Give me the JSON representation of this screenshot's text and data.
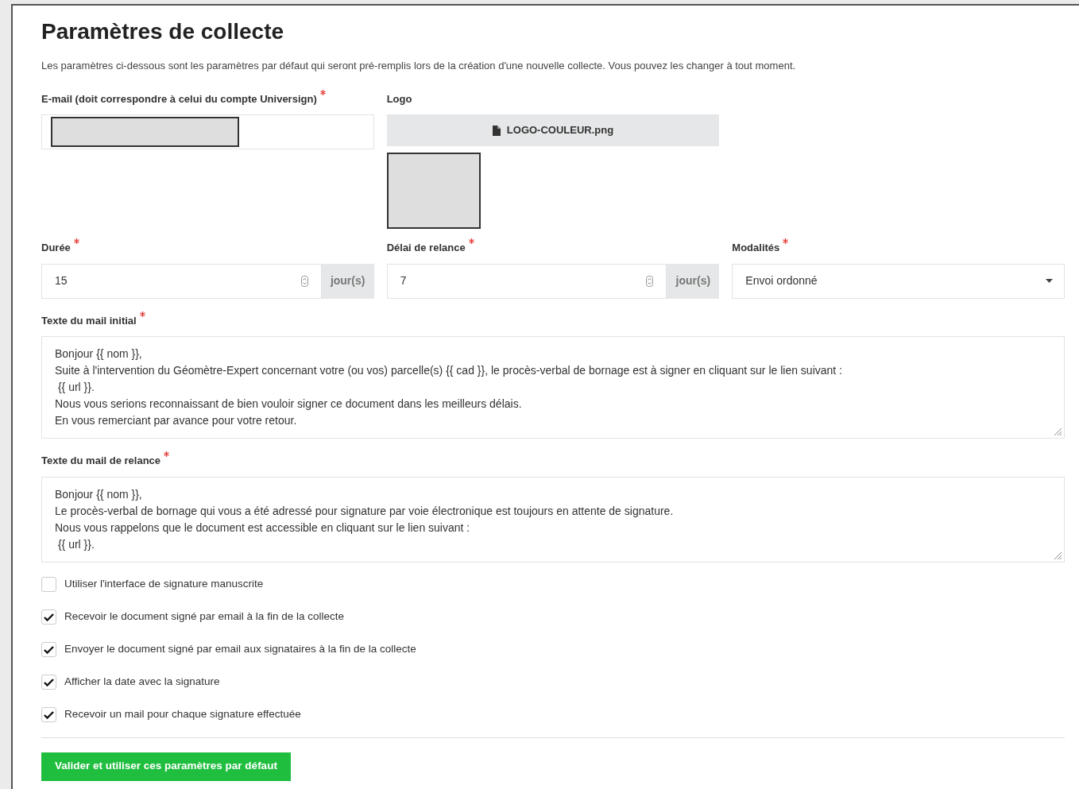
{
  "title": "Paramètres de collecte",
  "description": "Les paramètres ci-dessous sont les paramètres par défaut qui seront pré-remplis lors de la création d'une nouvelle collecte. Vous pouvez les changer à tout moment.",
  "email": {
    "label": "E-mail (doit correspondre à celui du compte Universign)",
    "required": true
  },
  "logo": {
    "label": "Logo",
    "file_name": "LOGO-COULEUR.png"
  },
  "duration": {
    "label": "Durée",
    "required": true,
    "value": "15",
    "unit": "jour(s)"
  },
  "reminder_delay": {
    "label": "Délai de relance",
    "required": true,
    "value": "7",
    "unit": "jour(s)"
  },
  "modalities": {
    "label": "Modalités",
    "required": true,
    "value": "Envoi ordonné"
  },
  "initial_mail": {
    "label": "Texte du mail initial",
    "required": true,
    "value": "Bonjour {{ nom }},\nSuite à l'intervention du Géomètre-Expert concernant votre (ou vos) parcelle(s) {{ cad }}, le procès-verbal de bornage est à signer en cliquant sur le lien suivant :\n {{ url }}.\nNous vous serions reconnaissant de bien vouloir signer ce document dans les meilleurs délais.\nEn vous remerciant par avance pour votre retour."
  },
  "reminder_mail": {
    "label": "Texte du mail de relance",
    "required": true,
    "value": "Bonjour {{ nom }},\nLe procès-verbal de bornage qui vous a été adressé pour signature par voie électronique est toujours en attente de signature.\nNous vous rappelons que le document est accessible en cliquant sur le lien suivant :\n {{ url }}."
  },
  "options": [
    {
      "label": "Utiliser l'interface de signature manuscrite",
      "checked": false
    },
    {
      "label": "Recevoir le document signé par email à la fin de la collecte",
      "checked": true
    },
    {
      "label": "Envoyer le document signé par email aux signataires à la fin de la collecte",
      "checked": true
    },
    {
      "label": "Afficher la date avec la signature",
      "checked": true
    },
    {
      "label": "Recevoir un mail pour chaque signature effectuée",
      "checked": true
    }
  ],
  "submit_button": "Valider et utiliser ces paramètres par défaut"
}
